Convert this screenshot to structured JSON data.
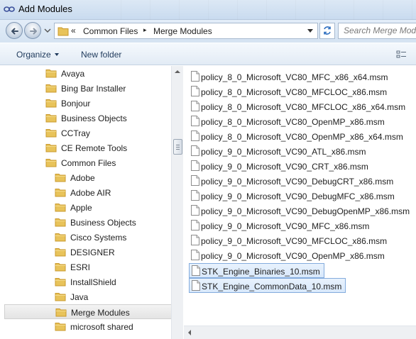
{
  "window": {
    "title": "Add Modules"
  },
  "address": {
    "overflow_chevron": "«",
    "crumbs": [
      "Common Files",
      "Merge Modules"
    ],
    "separator": "▸"
  },
  "search": {
    "placeholder": "Search Merge Modules"
  },
  "toolbar": {
    "organize_label": "Organize",
    "new_folder_label": "New folder"
  },
  "tree": {
    "items": [
      {
        "label": "Avaya",
        "level": 0
      },
      {
        "label": "Bing Bar Installer",
        "level": 0
      },
      {
        "label": "Bonjour",
        "level": 0
      },
      {
        "label": "Business Objects",
        "level": 0
      },
      {
        "label": "CCTray",
        "level": 0
      },
      {
        "label": "CE Remote Tools",
        "level": 0
      },
      {
        "label": "Common Files",
        "level": 0
      },
      {
        "label": "Adobe",
        "level": 1
      },
      {
        "label": "Adobe AIR",
        "level": 1
      },
      {
        "label": "Apple",
        "level": 1
      },
      {
        "label": "Business Objects",
        "level": 1
      },
      {
        "label": "Cisco Systems",
        "level": 1
      },
      {
        "label": "DESIGNER",
        "level": 1
      },
      {
        "label": "ESRI",
        "level": 1
      },
      {
        "label": "InstallShield",
        "level": 1
      },
      {
        "label": "Java",
        "level": 1
      },
      {
        "label": "Merge Modules",
        "level": 1,
        "selected": true
      },
      {
        "label": "microsoft shared",
        "level": 1
      }
    ]
  },
  "files": {
    "items": [
      {
        "name": "policy_8_0_Microsoft_VC80_MFC_x86_x64.msm"
      },
      {
        "name": "policy_8_0_Microsoft_VC80_MFCLOC_x86.msm"
      },
      {
        "name": "policy_8_0_Microsoft_VC80_MFCLOC_x86_x64.msm"
      },
      {
        "name": "policy_8_0_Microsoft_VC80_OpenMP_x86.msm"
      },
      {
        "name": "policy_8_0_Microsoft_VC80_OpenMP_x86_x64.msm"
      },
      {
        "name": "policy_9_0_Microsoft_VC90_ATL_x86.msm"
      },
      {
        "name": "policy_9_0_Microsoft_VC90_CRT_x86.msm"
      },
      {
        "name": "policy_9_0_Microsoft_VC90_DebugCRT_x86.msm"
      },
      {
        "name": "policy_9_0_Microsoft_VC90_DebugMFC_x86.msm"
      },
      {
        "name": "policy_9_0_Microsoft_VC90_DebugOpenMP_x86.msm"
      },
      {
        "name": "policy_9_0_Microsoft_VC90_MFC_x86.msm"
      },
      {
        "name": "policy_9_0_Microsoft_VC90_MFCLOC_x86.msm"
      },
      {
        "name": "policy_9_0_Microsoft_VC90_OpenMP_x86.msm"
      },
      {
        "name": "STK_Engine_Binaries_10.msm",
        "selected": true
      },
      {
        "name": "STK_Engine_CommonData_10.msm",
        "selected": true
      }
    ]
  },
  "colors": {
    "folder": "#e8c35a",
    "folder_dark": "#c9982c",
    "selection_border": "#84acdd",
    "link_text": "#1e395b"
  }
}
